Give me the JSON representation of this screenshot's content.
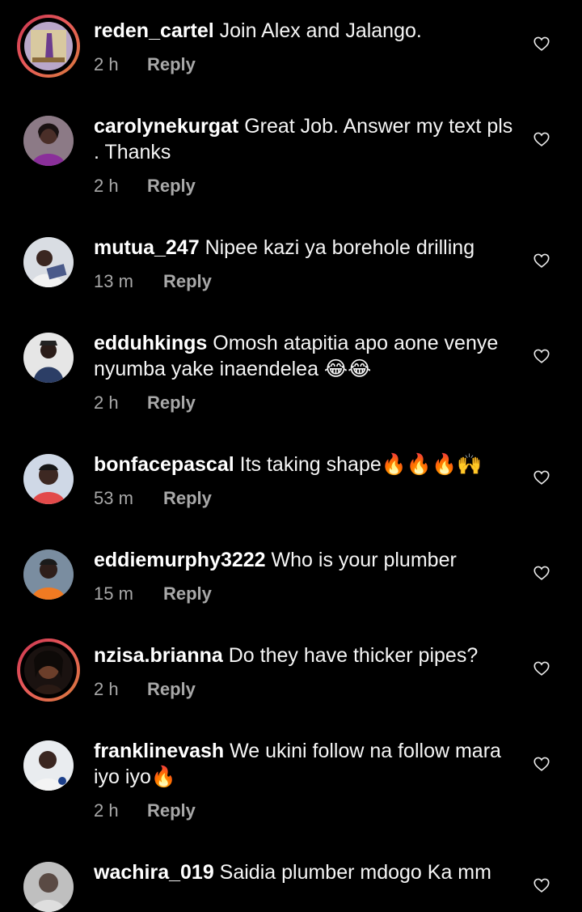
{
  "colors": {
    "background": "#000000",
    "text": "#f5f5f5",
    "meta": "#a8a8a8",
    "story_ring": "#e04d5a"
  },
  "comments": [
    {
      "username": "reden_cartel",
      "text": "Join Alex and Jalango.",
      "time": "2 h",
      "reply": "Reply",
      "has_story_ring": true,
      "like_icon": "heart-outline-icon"
    },
    {
      "username": "carolynekurgat",
      "text": "Great Job.  Answer my text pls . Thanks",
      "time": "2 h",
      "reply": "Reply",
      "has_story_ring": false,
      "like_icon": "heart-outline-icon"
    },
    {
      "username": "mutua_247",
      "text": "Nipee kazi ya borehole drilling",
      "time": "13 m",
      "reply": "Reply",
      "has_story_ring": false,
      "like_icon": "heart-outline-icon"
    },
    {
      "username": "edduhkings",
      "text": "Omosh atapitia apo aone venye nyumba yake inaendelea 😂😂",
      "time": "2 h",
      "reply": "Reply",
      "has_story_ring": false,
      "like_icon": "heart-outline-icon"
    },
    {
      "username": "bonfacepascal",
      "text": "Its taking shape🔥🔥🔥🙌",
      "time": "53 m",
      "reply": "Reply",
      "has_story_ring": false,
      "like_icon": "heart-outline-icon"
    },
    {
      "username": "eddiemurphy3222",
      "text": "Who is your plumber",
      "time": "15 m",
      "reply": "Reply",
      "has_story_ring": false,
      "like_icon": "heart-outline-icon"
    },
    {
      "username": "nzisa.brianna",
      "text": "Do they have thicker pipes?",
      "time": "2 h",
      "reply": "Reply",
      "has_story_ring": true,
      "like_icon": "heart-outline-icon"
    },
    {
      "username": "franklinevash",
      "text": "We ukini follow na follow mara iyo iyo🔥",
      "time": "2 h",
      "reply": "Reply",
      "has_story_ring": false,
      "like_icon": "heart-outline-icon"
    },
    {
      "username": "wachira_019",
      "text": "Saidia plumber mdogo Ka mm",
      "time": "",
      "reply": "",
      "has_story_ring": false,
      "like_icon": "heart-outline-icon"
    }
  ]
}
